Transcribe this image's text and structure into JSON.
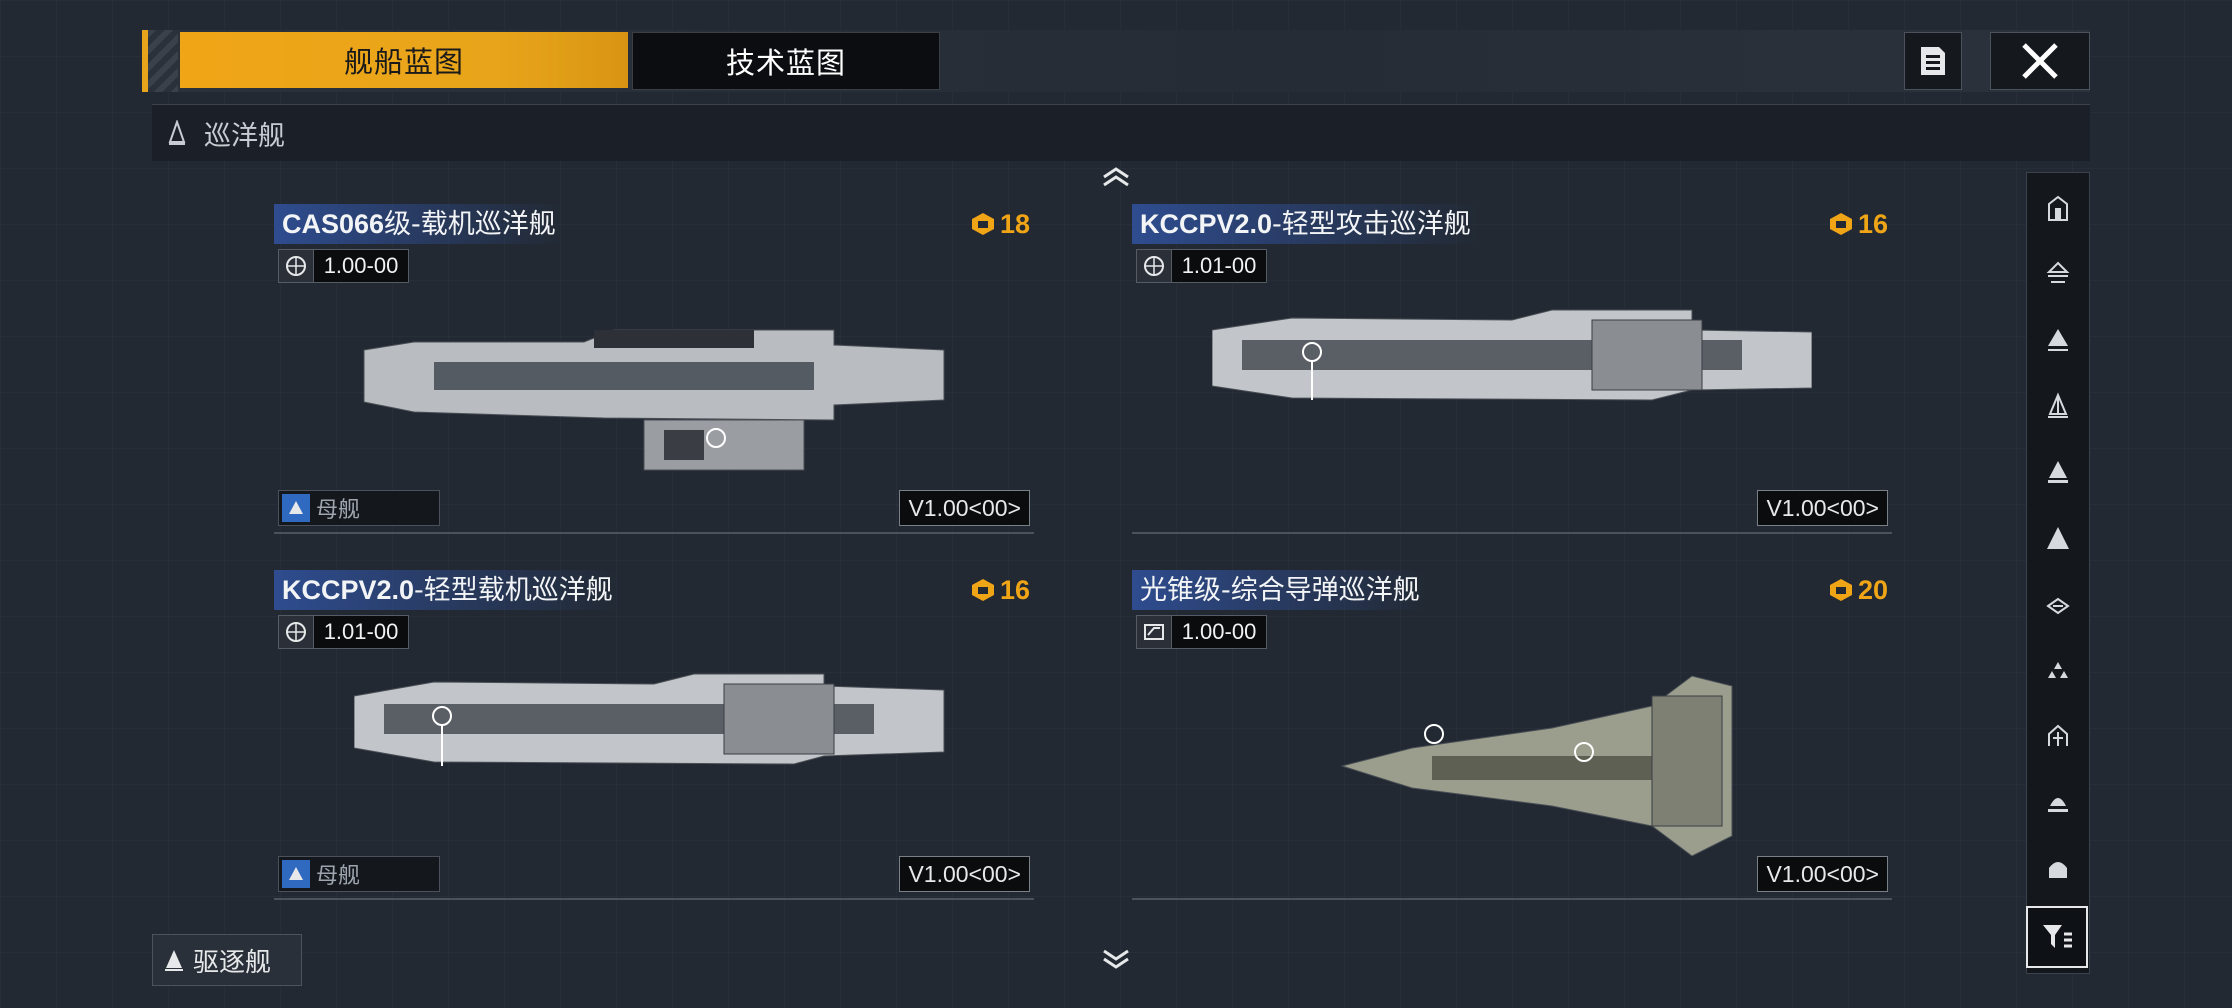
{
  "tabs": [
    {
      "label": "舰船蓝图",
      "active": true
    },
    {
      "label": "技术蓝图",
      "active": false
    }
  ],
  "category": {
    "label": "巡洋舰"
  },
  "next_category": {
    "label": "驱逐舰"
  },
  "colors": {
    "accent": "#e8a51b",
    "title_bg": "#2e4c8f",
    "cost": "#f0a516",
    "role_icon": "#2f6ac0"
  },
  "ships": [
    {
      "name_latin": "CAS066",
      "name_rest": "级-载机巡洋舰",
      "cost": "18",
      "faction_icon": "globe-icon",
      "faction_value": "1.00-00",
      "role": "母舰",
      "version": "V1.00<00>"
    },
    {
      "name_latin": "KCCPV2.0",
      "name_rest": "-轻型攻击巡洋舰",
      "cost": "16",
      "faction_icon": "globe-icon",
      "faction_value": "1.01-00",
      "role": "",
      "version": "V1.00<00>"
    },
    {
      "name_latin": "KCCPV2.0",
      "name_rest": "-轻型载机巡洋舰",
      "cost": "16",
      "faction_icon": "globe-icon",
      "faction_value": "1.01-00",
      "role": "母舰",
      "version": "V1.00<00>"
    },
    {
      "name_latin": "",
      "name_rest": "光锥级-综合导弹巡洋舰",
      "cost": "20",
      "faction_icon": "faction-logo-icon",
      "faction_value": "1.00-00",
      "role": "",
      "version": "V1.00<00>"
    }
  ],
  "sidebar_filters": [
    "frigate-icon",
    "corvette-icon",
    "destroyer-icon",
    "cruiser-icon",
    "battlecruiser-icon",
    "battleship-icon",
    "carrier-icon",
    "aux-ship-icon",
    "station-icon",
    "cap-ship-icon",
    "hull-icon"
  ]
}
